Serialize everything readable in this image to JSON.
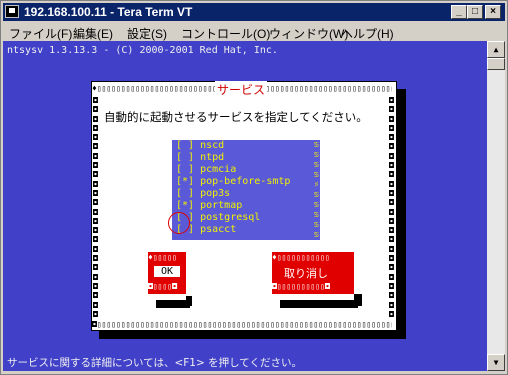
{
  "window": {
    "title": "192.168.100.11 - Tera Term VT",
    "buttons": {
      "minimize": "_",
      "maximize": "□",
      "close": "×"
    }
  },
  "menubar": [
    "ファイル(F)",
    "編集(E)",
    "設定(S)",
    "コントロール(O)",
    "ウィンドウ(W)",
    "ヘルプ(H)"
  ],
  "terminal": {
    "header": "ntsysv 1.3.13.3 - (C) 2000-2001 Red Hat, Inc.",
    "footer": "サービスに関する詳細については、<F1> を押してください。"
  },
  "dialog": {
    "title": "サービス",
    "instruction": "自動的に起動させるサービスを指定してください。",
    "services": [
      {
        "mark": "[ ]",
        "name": "nscd"
      },
      {
        "mark": "[ ]",
        "name": "ntpd"
      },
      {
        "mark": "[ ]",
        "name": "pcmcia"
      },
      {
        "mark": "[*]",
        "name": "pop-before-smtp"
      },
      {
        "mark": "[ ]",
        "name": "pop3s"
      },
      {
        "mark": "[*]",
        "name": "portmap"
      },
      {
        "mark": "[ ]",
        "name": "postgresql"
      },
      {
        "mark": "[ ]",
        "name": "psacct"
      }
    ],
    "ok_label": "OK",
    "cancel_label": "取り消し"
  },
  "colors": {
    "terminal_bg": "#4040c8",
    "listbox_bg": "#5a5ad8",
    "listbox_text": "#f0f000",
    "button_bg": "#e00000",
    "title_text": "#d00000",
    "annotation_circle": "#e00000"
  }
}
